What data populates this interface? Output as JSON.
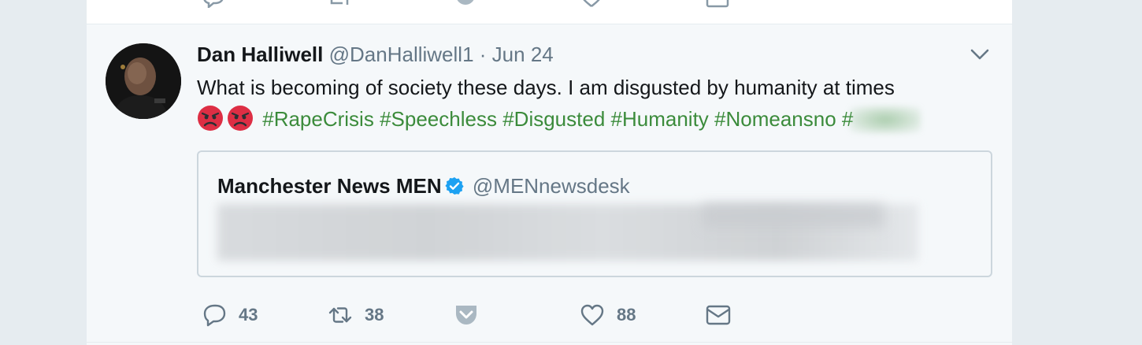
{
  "tweet": {
    "author": {
      "name": "Dan Halliwell",
      "handle": "@DanHalliwell1",
      "separator": "·",
      "date": "Jun 24"
    },
    "text_line1": "What is becoming of society these days. I am disgusted by humanity at times",
    "emojis": [
      "angry-face-icon",
      "angry-face-icon"
    ],
    "hashtags": [
      "#RapeCrisis",
      "#Speechless",
      "#Disgusted",
      "#Humanity",
      "#Nomeansno",
      "#"
    ],
    "quoted": {
      "name": "Manchester News MEN",
      "verified": true,
      "handle": "@MENnewsdesk"
    },
    "actions": {
      "reply": {
        "icon": "reply-icon",
        "count": "43"
      },
      "retweet": {
        "icon": "retweet-icon",
        "count": "38"
      },
      "pocket": {
        "icon": "pocket-icon"
      },
      "like": {
        "icon": "heart-icon",
        "count": "88"
      },
      "dm": {
        "icon": "envelope-icon"
      }
    }
  },
  "colors": {
    "hashtag": "#3b8b3b",
    "verified": "#1da1f2",
    "muted": "#657786",
    "background": "#e6ecf0"
  }
}
